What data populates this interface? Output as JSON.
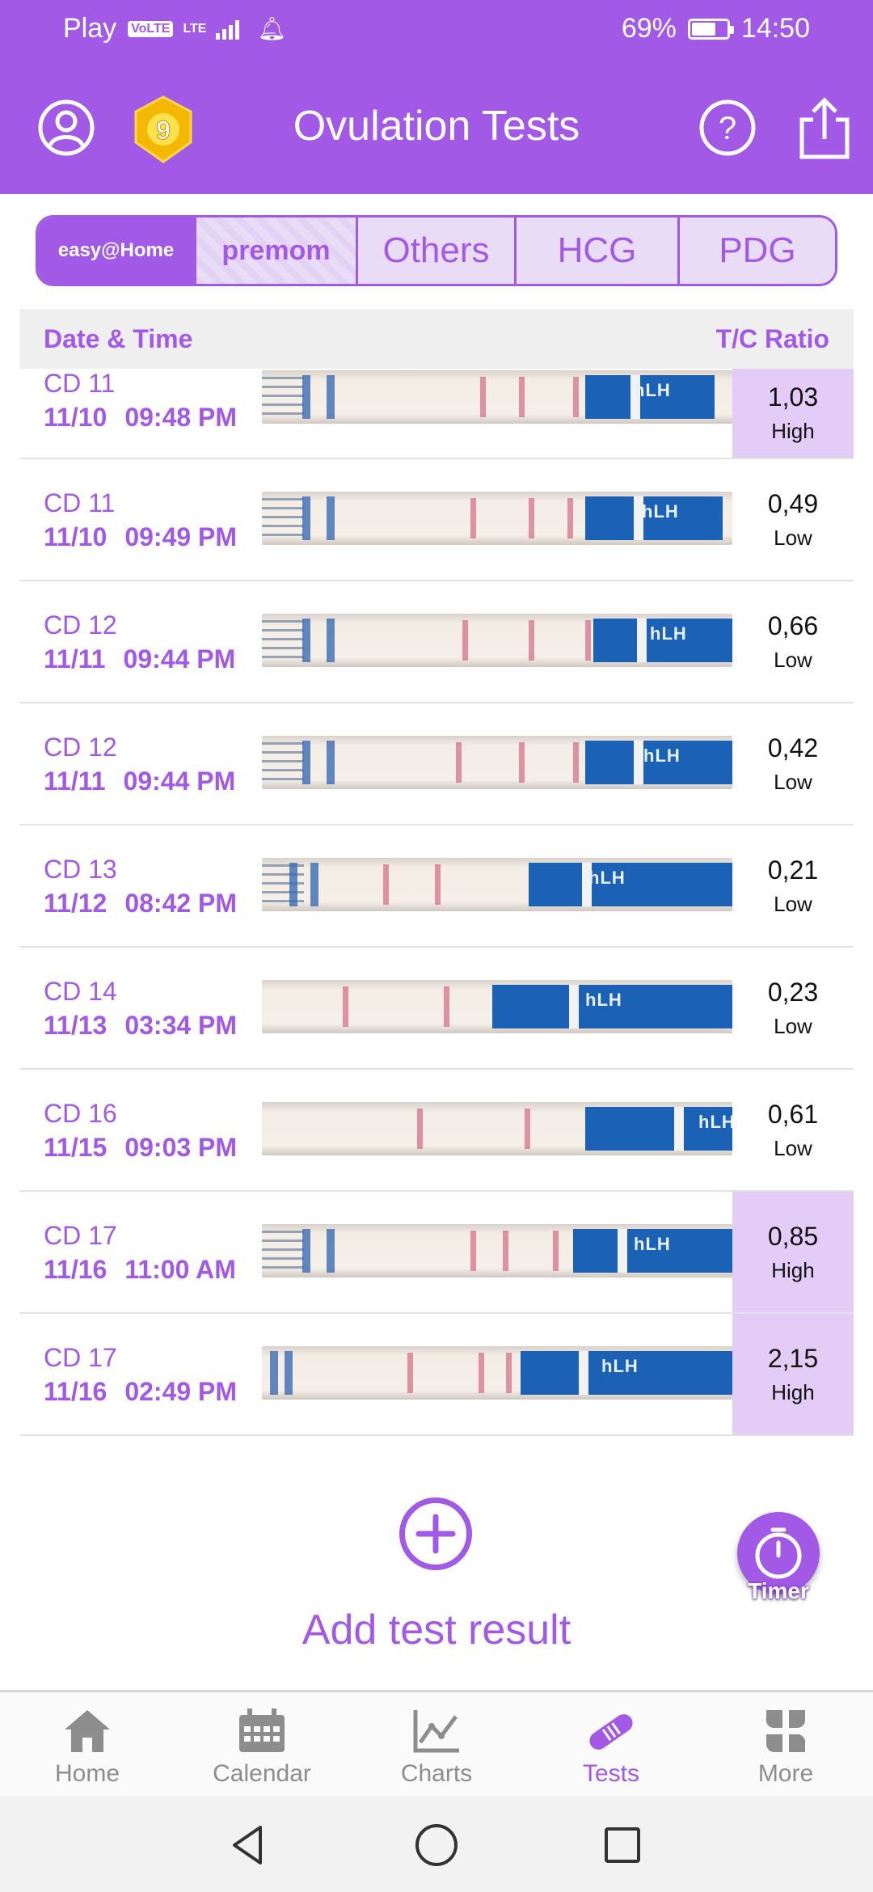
{
  "status_bar": {
    "carrier": "Play",
    "volte": "VoLTE",
    "network": "LTE",
    "battery": "69%",
    "battery_level": 0.69,
    "time": "14:50"
  },
  "app_bar": {
    "title": "Ovulation Tests",
    "medal_count": "9"
  },
  "brand_tabs": [
    {
      "label": "easy@Home",
      "selected": true
    },
    {
      "label": "premom",
      "selected": false
    },
    {
      "label": "Others",
      "selected": false
    },
    {
      "label": "HCG",
      "selected": false
    },
    {
      "label": "PDG",
      "selected": false
    }
  ],
  "table": {
    "col_date": "Date & Time",
    "col_ratio": "T/C Ratio",
    "rows": [
      {
        "cd": "CD 11",
        "date": "11/10",
        "time": "09:48 PM",
        "ratio": "1,03",
        "level": "High"
      },
      {
        "cd": "CD 11",
        "date": "11/10",
        "time": "09:49 PM",
        "ratio": "0,49",
        "level": "Low"
      },
      {
        "cd": "CD 12",
        "date": "11/11",
        "time": "09:44 PM",
        "ratio": "0,66",
        "level": "Low"
      },
      {
        "cd": "CD 12",
        "date": "11/11",
        "time": "09:44 PM",
        "ratio": "0,42",
        "level": "Low"
      },
      {
        "cd": "CD 13",
        "date": "11/12",
        "time": "08:42 PM",
        "ratio": "0,21",
        "level": "Low"
      },
      {
        "cd": "CD 14",
        "date": "11/13",
        "time": "03:34 PM",
        "ratio": "0,23",
        "level": "Low"
      },
      {
        "cd": "CD 16",
        "date": "11/15",
        "time": "09:03 PM",
        "ratio": "0,61",
        "level": "Low"
      },
      {
        "cd": "CD 17",
        "date": "11/16",
        "time": "11:00 AM",
        "ratio": "0,85",
        "level": "High"
      },
      {
        "cd": "CD 17",
        "date": "11/16",
        "time": "02:49 PM",
        "ratio": "2,15",
        "level": "High"
      }
    ],
    "strip_label": "hLH"
  },
  "add_test": {
    "label": "Add test result"
  },
  "timer": {
    "label": "Timer"
  },
  "bottom_nav": [
    {
      "label": "Home",
      "icon": "home-icon",
      "active": false
    },
    {
      "label": "Calendar",
      "icon": "calendar-icon",
      "active": false
    },
    {
      "label": "Charts",
      "icon": "chart-icon",
      "active": false
    },
    {
      "label": "Tests",
      "icon": "test-strip-icon",
      "active": true
    },
    {
      "label": "More",
      "icon": "more-icon",
      "active": false
    }
  ],
  "colors": {
    "accent": "#a259e6",
    "high_bg": "#e3cdf7",
    "strip_blue": "#1b62b6"
  }
}
